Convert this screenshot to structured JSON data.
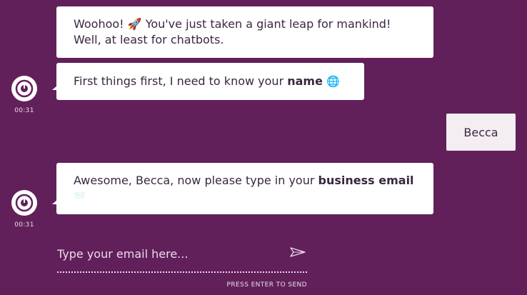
{
  "colors": {
    "background": "#62205a",
    "bubble": "#ffffff",
    "user_bubble": "#f4eef3",
    "text": "#3b2740"
  },
  "messages": [
    {
      "sender": "bot",
      "line1": "Woohoo! 🚀 You've just taken a giant leap for mankind!",
      "line2": "Well, at least for chatbots."
    },
    {
      "sender": "bot",
      "text_before": "First things first, I need to know your ",
      "bold": "name",
      "emoji": "🌐",
      "time": "00:31"
    },
    {
      "sender": "user",
      "text": "Becca"
    },
    {
      "sender": "bot",
      "text_before": "Awesome, Becca, now please type in your ",
      "bold": "business email",
      "emoji": "📨",
      "time": "00:31"
    }
  ],
  "composer": {
    "placeholder": "Type your email here...",
    "hint": "PRESS ENTER TO SEND",
    "send_icon": "paper-plane-icon"
  },
  "bot_avatar_icon": "bot-eye-icon"
}
